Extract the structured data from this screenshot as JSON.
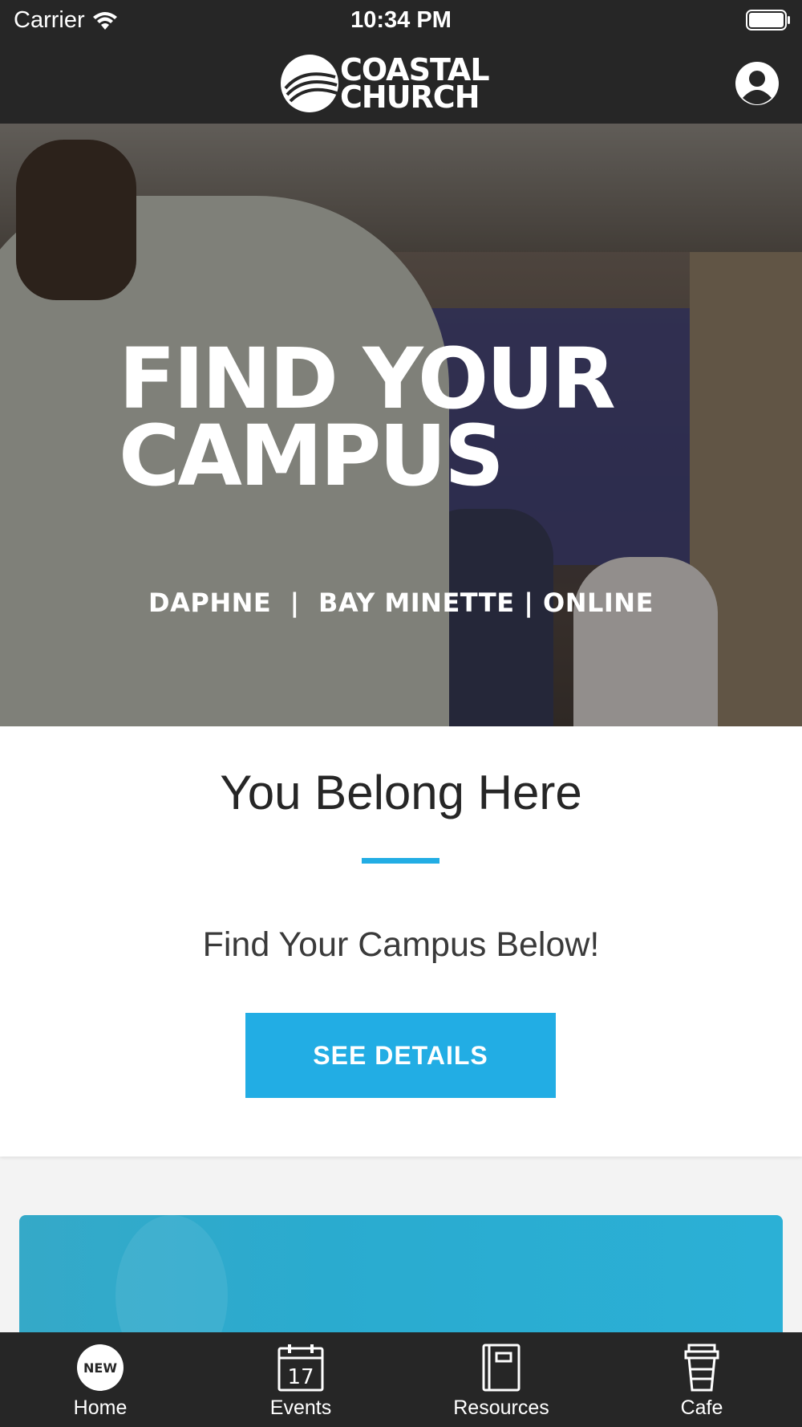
{
  "status_bar": {
    "carrier": "Carrier",
    "time": "10:34 PM"
  },
  "header": {
    "logo_text_line1": "COASTAL",
    "logo_text_line2": "CHURCH"
  },
  "hero": {
    "title_line1": "FIND YOUR",
    "title_line2": "CAMPUS",
    "subtitle": "DAPHNE  |  BAY MINETTE | ONLINE"
  },
  "intro": {
    "title": "You Belong Here",
    "text": "Find Your Campus Below!",
    "button_label": "SEE DETAILS"
  },
  "colors": {
    "accent": "#22ade4",
    "bar_background": "#262626"
  },
  "tabs": [
    {
      "label": "Home",
      "icon": "new-badge-icon",
      "badge": "NEW"
    },
    {
      "label": "Events",
      "icon": "calendar-icon",
      "day": "17"
    },
    {
      "label": "Resources",
      "icon": "book-icon"
    },
    {
      "label": "Cafe",
      "icon": "coffee-cup-icon"
    }
  ]
}
